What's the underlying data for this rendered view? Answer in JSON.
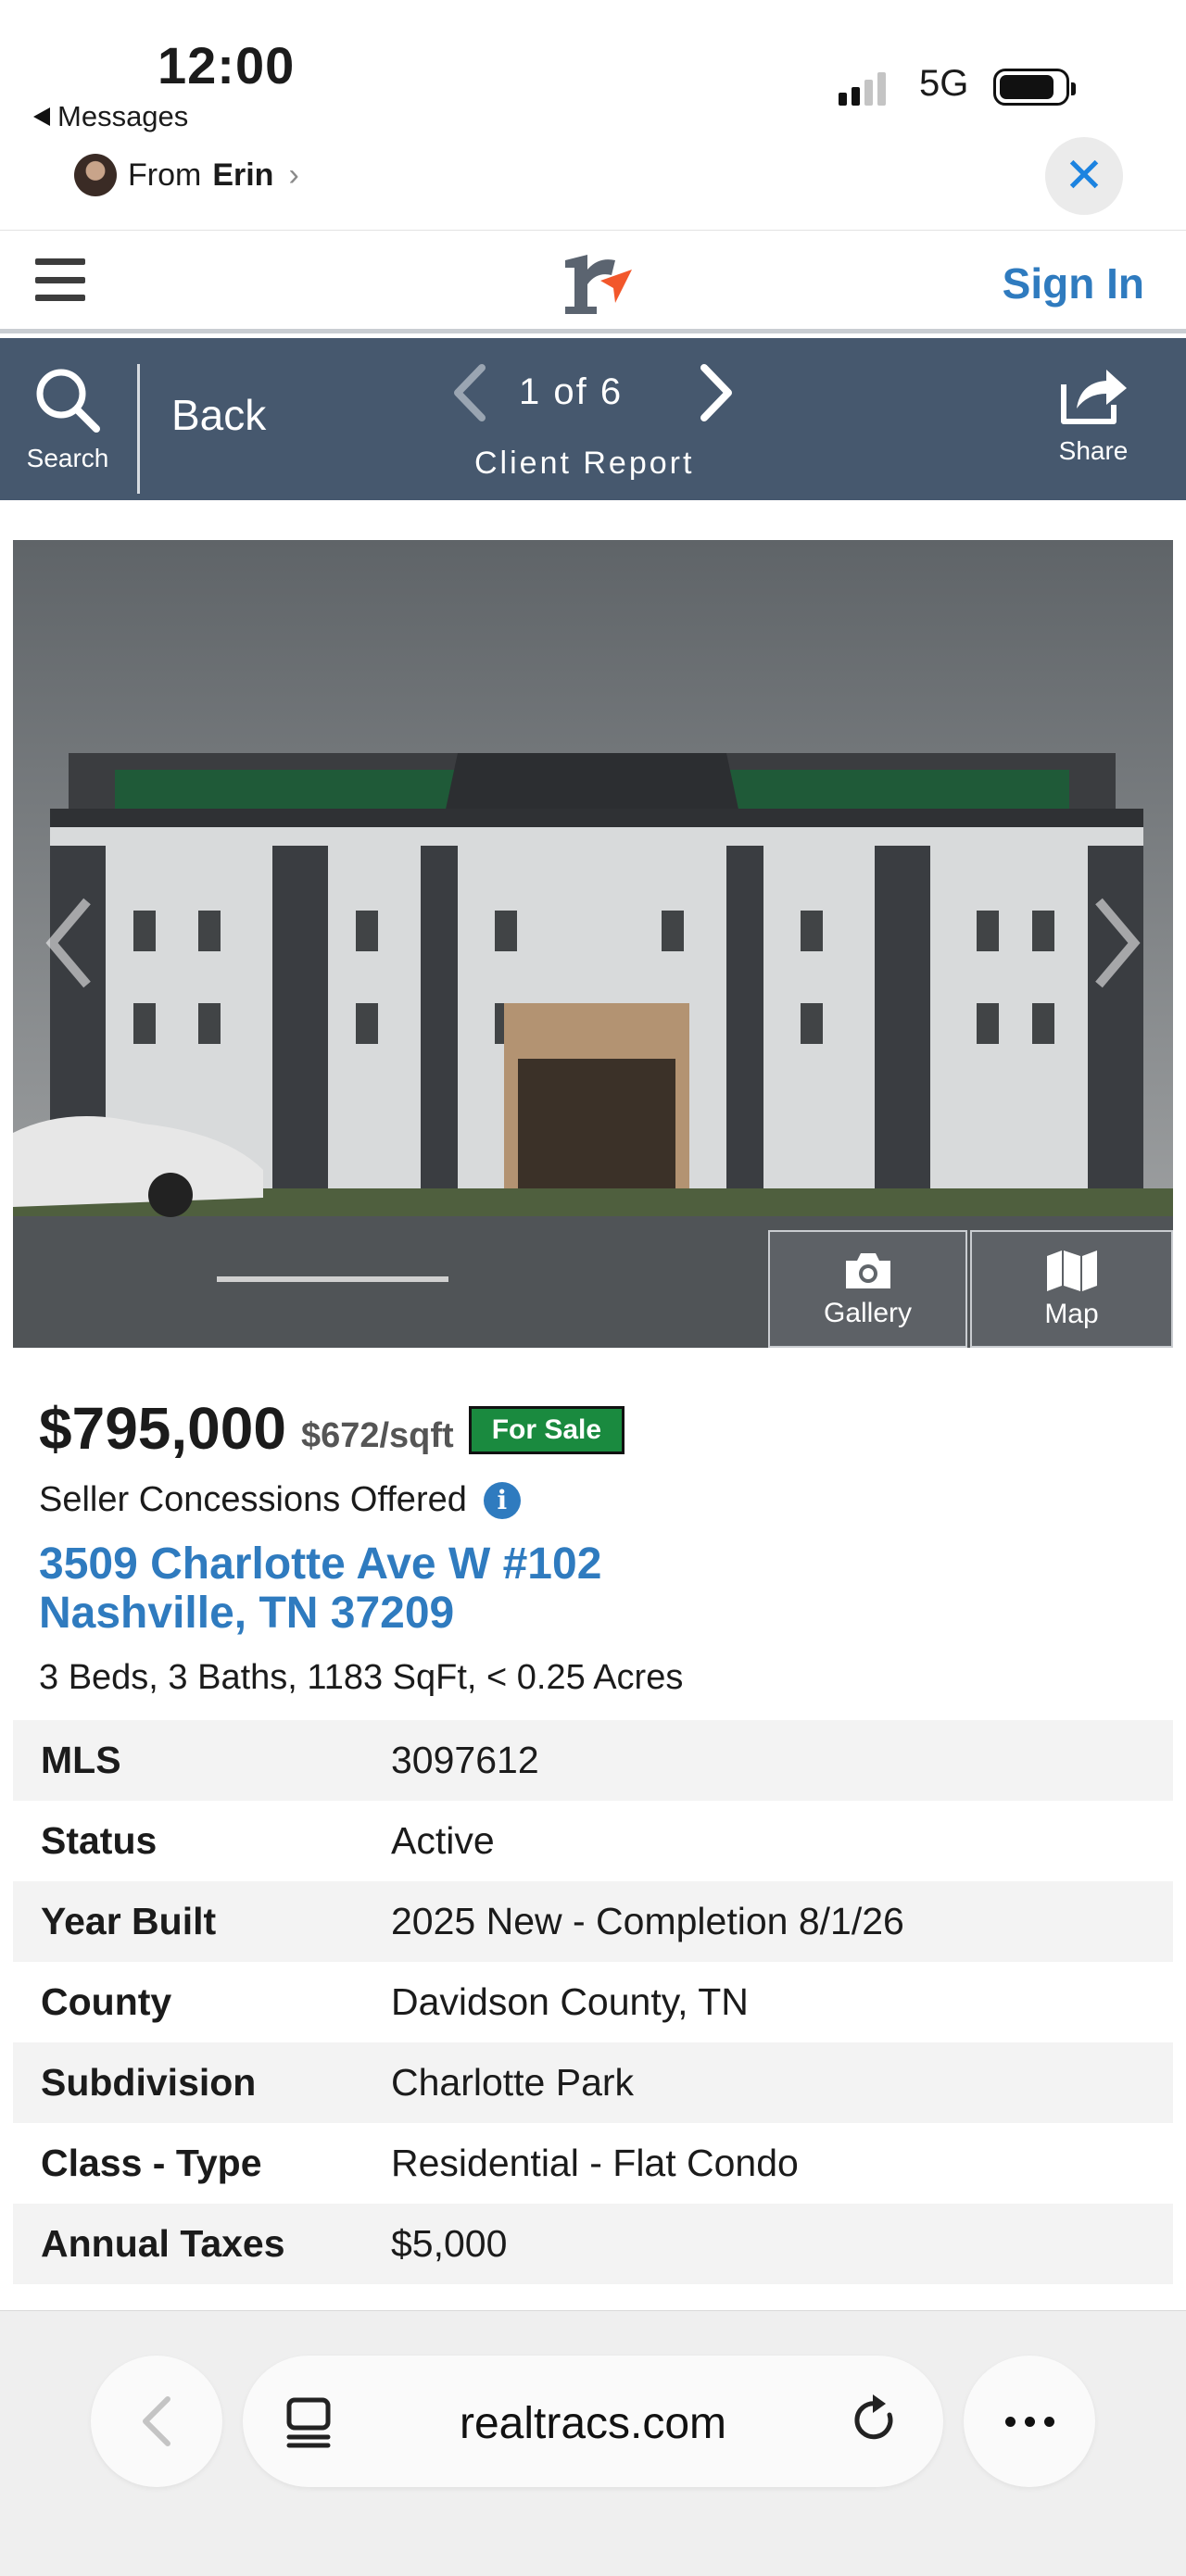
{
  "status_bar": {
    "time": "12:00",
    "back_app": "Messages",
    "from_prefix": "From",
    "from_name": "Erin",
    "network": "5G"
  },
  "header": {
    "sign_in": "Sign In"
  },
  "toolbar": {
    "search_label": "Search",
    "back_label": "Back",
    "page_count": "1 of 6",
    "report_label": "Client Report",
    "share_label": "Share"
  },
  "photo": {
    "gallery_label": "Gallery",
    "map_label": "Map"
  },
  "listing": {
    "price": "$795,000",
    "price_per_sqft": "$672/sqft",
    "status_badge": "For Sale",
    "concessions": "Seller Concessions Offered",
    "address_line1": "3509 Charlotte Ave W #102",
    "address_line2": "Nashville, TN 37209",
    "facts": "3 Beds, 3 Baths, 1183 SqFt, < 0.25 Acres",
    "details": [
      {
        "label": "MLS",
        "value": "3097612"
      },
      {
        "label": "Status",
        "value": "Active"
      },
      {
        "label": "Year Built",
        "value": "2025 New - Completion 8/1/26"
      },
      {
        "label": "County",
        "value": "Davidson County, TN"
      },
      {
        "label": "Subdivision",
        "value": "Charlotte Park"
      },
      {
        "label": "Class - Type",
        "value": "Residential - Flat Condo"
      },
      {
        "label": "Annual Taxes",
        "value": "$5,000"
      }
    ]
  },
  "safari": {
    "domain": "realtracs.com"
  },
  "colors": {
    "accent_blue": "#2f7bbf",
    "toolbar_bg": "#46586e",
    "for_sale_green": "#1a8a3f",
    "logo_orange": "#f2572b",
    "close_blue": "#1c83e0"
  }
}
